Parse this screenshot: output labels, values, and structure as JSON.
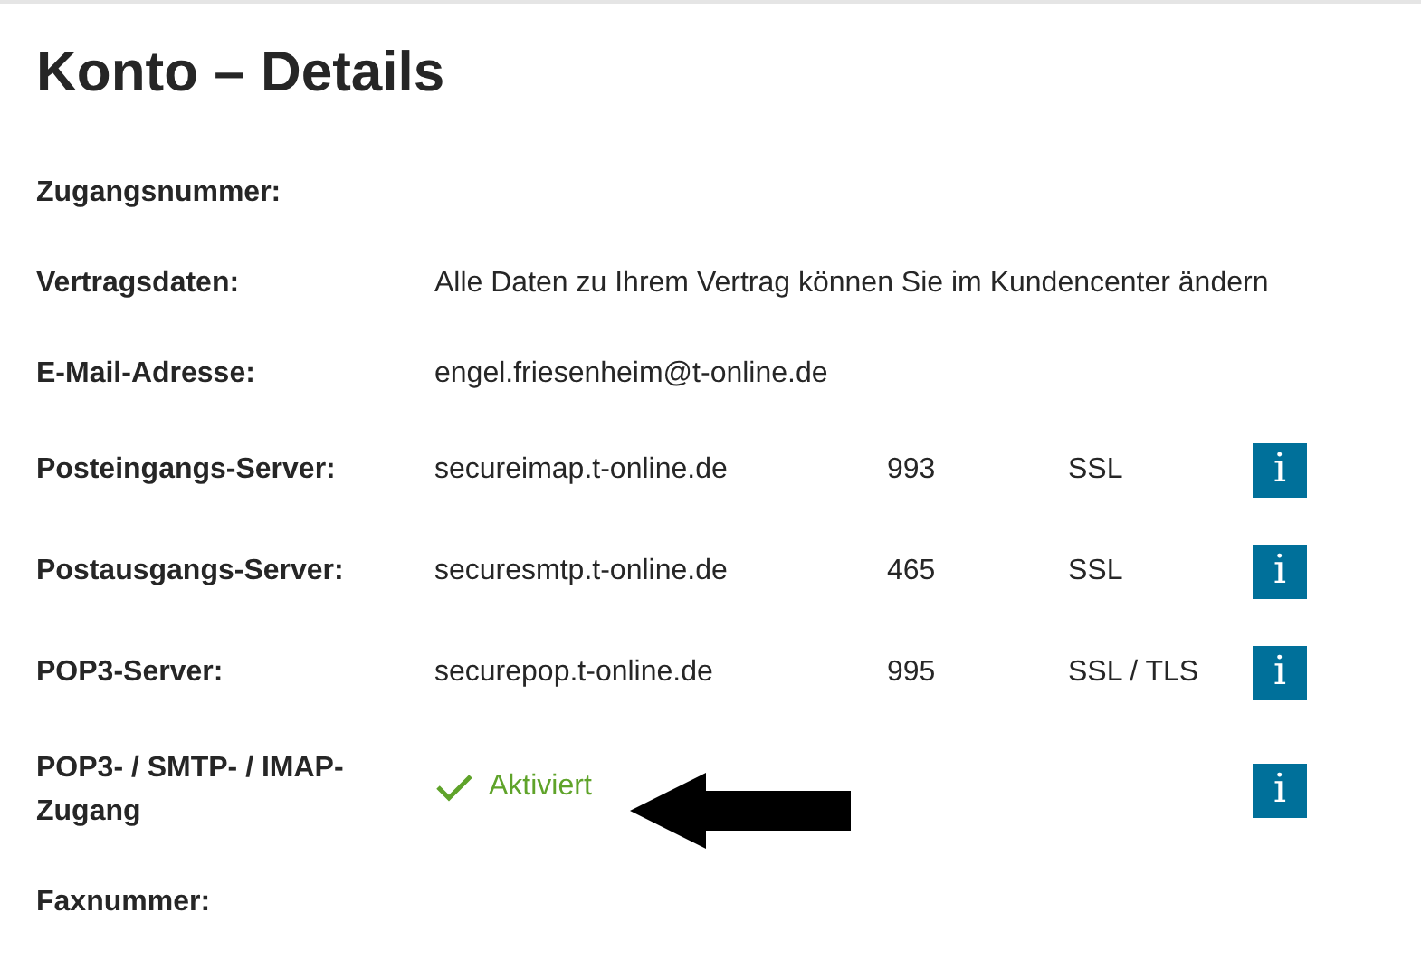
{
  "title": "Konto – Details",
  "rows": [
    {
      "label": "Zugangsnummer:"
    },
    {
      "label": "Vertragsdaten:",
      "value": "Alle Daten zu Ihrem Vertrag können Sie im Kundencenter ändern"
    },
    {
      "label": "E-Mail-Adresse:",
      "value": "engel.friesenheim@t-online.de"
    },
    {
      "label": "Posteingangs-Server:",
      "value": "secureimap.t-online.de",
      "port": "993",
      "security": "SSL",
      "info": "i"
    },
    {
      "label": "Postausgangs-Server:",
      "value": "securesmtp.t-online.de",
      "port": "465",
      "security": "SSL",
      "info": "i"
    },
    {
      "label": "POP3-Server:",
      "value": "securepop.t-online.de",
      "port": "995",
      "security": "SSL / TLS",
      "info": "i"
    },
    {
      "label": "POP3- / SMTP- / IMAP-Zugang",
      "status": {
        "text": "Aktiviert",
        "activated": true
      },
      "info": "i",
      "annotated": true
    },
    {
      "label": "Faxnummer:"
    }
  ]
}
